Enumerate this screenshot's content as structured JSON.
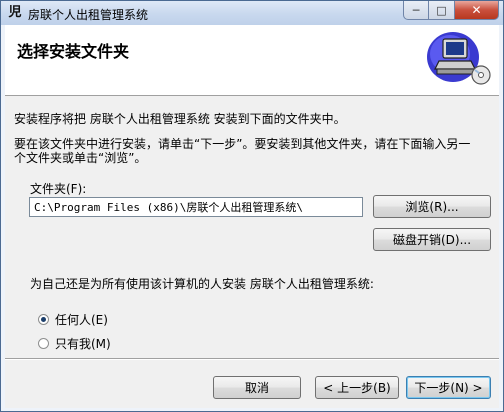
{
  "window": {
    "title": "房联个人出租管理系统",
    "controls": {
      "minimize": "─",
      "maximize": "□",
      "close": "✕"
    }
  },
  "header": {
    "title": "选择安装文件夹"
  },
  "body": {
    "intro": "安装程序将把 房联个人出租管理系统 安装到下面的文件夹中。",
    "instruction_line1": "要在该文件夹中进行安装，请单击“下一步”。要安装到其他文件夹，请在下面输入另一",
    "instruction_line2": "个文件夹或单击“浏览”。",
    "folder_label": "文件夹(F):",
    "folder_value": "C:\\Program Files (x86)\\房联个人出租管理系统\\",
    "browse_button": "浏览(R)...",
    "disk_cost_button": "磁盘开销(D)...",
    "install_for_label": "为自己还是为所有使用该计算机的人安装 房联个人出租管理系统:",
    "radio_everyone": "任何人(E)",
    "radio_just_me": "只有我(M)",
    "selected_option": "everyone"
  },
  "footer": {
    "cancel": "取消",
    "back": "< 上一步(B)",
    "next": "下一步(N) >"
  },
  "colors": {
    "title_gradient": "#c8d8ee",
    "close_button": "#c9503d",
    "header_background": "#ffffff",
    "content_background": "#f0f0f0",
    "default_button_border": "#3c7fb1"
  }
}
